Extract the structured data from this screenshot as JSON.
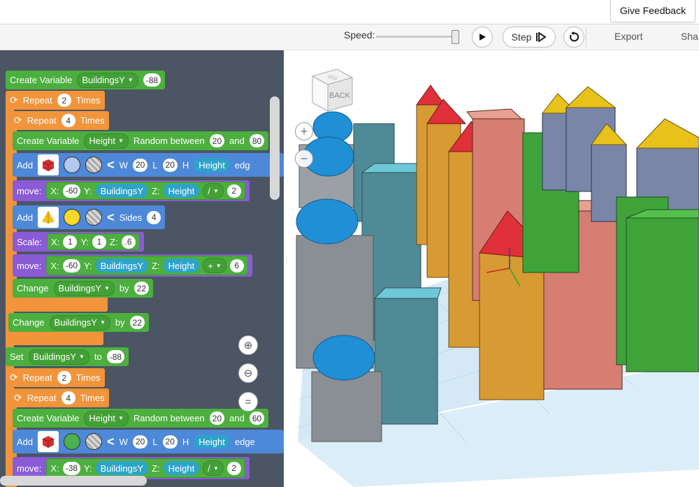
{
  "top": {
    "give_feedback": "Give Feedback"
  },
  "toolbar": {
    "speed_label": "Speed:",
    "step_label": "Step",
    "export_label": "Export",
    "share_label": "Sha"
  },
  "blocks": {
    "b1": {
      "prefix": "Create Variable",
      "var": "BuildingsY",
      "value": "-88"
    },
    "b2": {
      "prefix": "Repeat",
      "count": "2",
      "suffix": "Times"
    },
    "b3": {
      "prefix": "Repeat",
      "count": "4",
      "suffix": "Times"
    },
    "b4": {
      "prefix": "Create Variable",
      "var": "Height",
      "mid": "Random between",
      "min": "20",
      "and": "and",
      "max": "80"
    },
    "b5": {
      "prefix": "Add",
      "shape_color": "#d32f2f",
      "fill_color": "#b3c8ee",
      "w_label": "W",
      "w": "20",
      "l_label": "L",
      "l": "20",
      "h_label": "H",
      "h": "Height",
      "tail": "edg"
    },
    "b6": {
      "prefix": "move:",
      "x_label": "X:",
      "x": "-60",
      "y_label": "Y:",
      "y": "BuildingsY",
      "z_label": "Z:",
      "z": "Height",
      "op": "/",
      "num": "2"
    },
    "b7": {
      "prefix": "Add",
      "shape_color": "#f2c21b",
      "fill_color": "#ffd82a",
      "sides_label": "Sides",
      "sides": "4"
    },
    "b8": {
      "prefix": "Scale:",
      "x_label": "X:",
      "x": "1",
      "y_label": "Y:",
      "y": "1",
      "z_label": "Z:",
      "z": ".6"
    },
    "b9": {
      "prefix": "move:",
      "x_label": "X:",
      "x": "-60",
      "y_label": "Y:",
      "y": "BuildingsY",
      "z_label": "Z:",
      "z": "Height",
      "op": "+",
      "num": "6"
    },
    "b10": {
      "prefix": "Change",
      "var": "BuildingsY",
      "by": "by",
      "value": "22"
    },
    "b11": {
      "prefix": "Change",
      "var": "BuildingsY",
      "by": "by",
      "value": "22"
    },
    "b12": {
      "prefix": "Set",
      "var": "BuildingsY",
      "to": "to",
      "value": "-88"
    },
    "b13": {
      "prefix": "Repeat",
      "count": "2",
      "suffix": "Times"
    },
    "b14": {
      "prefix": "Repeat",
      "count": "4",
      "suffix": "Times"
    },
    "b15": {
      "prefix": "Create Variable",
      "var": "Height",
      "mid": "Random between",
      "min": "20",
      "and": "and",
      "max": "60"
    },
    "b16": {
      "prefix": "Add",
      "shape_color": "#d32f2f",
      "fill_color": "#4caf50",
      "w_label": "W",
      "w": "20",
      "l_label": "L",
      "l": "20",
      "h_label": "H",
      "h": "Height",
      "tail": "edge"
    },
    "b17": {
      "prefix": "move:",
      "x_label": "X:",
      "x": "-38",
      "y_label": "Y:",
      "y": "BuildingsY",
      "z_label": "Z:",
      "z": "Height",
      "op": "/",
      "num": "2"
    }
  },
  "viewcube": {
    "face": "BACK",
    "top": "TOP"
  },
  "colors": {
    "block_green": "#4caf3e",
    "block_orange": "#f1943a",
    "block_blue": "#4e88d8",
    "block_purple": "#8b5bd6",
    "panel_bg": "#4b5563"
  }
}
